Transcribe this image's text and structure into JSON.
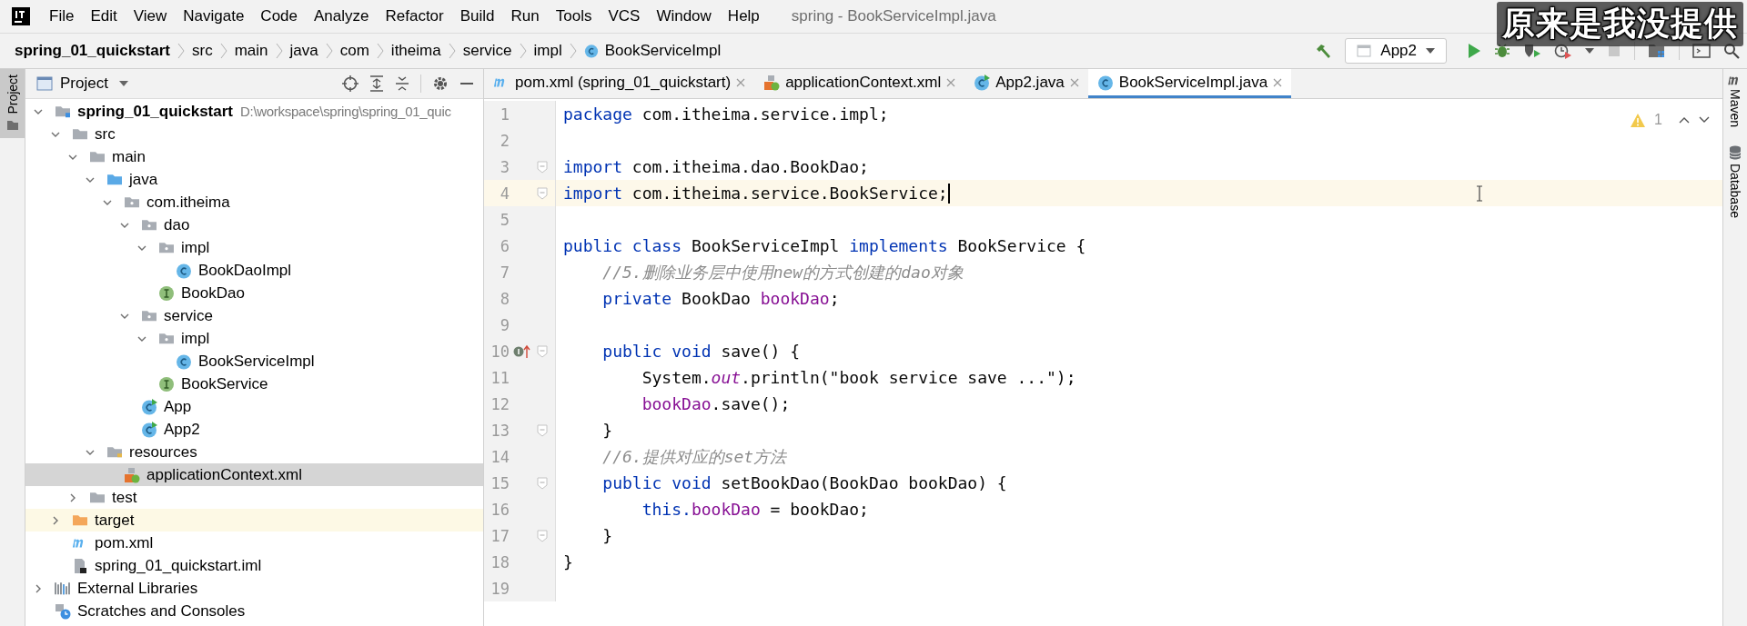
{
  "window": {
    "title": "spring - BookServiceImpl.java"
  },
  "menu": [
    "File",
    "Edit",
    "View",
    "Navigate",
    "Code",
    "Analyze",
    "Refactor",
    "Build",
    "Run",
    "Tools",
    "VCS",
    "Window",
    "Help"
  ],
  "subtitle": "原来是我没提供",
  "breadcrumbs": [
    {
      "label": "spring_01_quickstart",
      "kind": "project"
    },
    {
      "label": "src",
      "kind": "folder"
    },
    {
      "label": "main",
      "kind": "folder"
    },
    {
      "label": "java",
      "kind": "folder"
    },
    {
      "label": "com",
      "kind": "folder"
    },
    {
      "label": "itheima",
      "kind": "folder"
    },
    {
      "label": "service",
      "kind": "folder"
    },
    {
      "label": "impl",
      "kind": "folder"
    },
    {
      "label": "BookServiceImpl",
      "kind": "class"
    }
  ],
  "toolbar": {
    "run_config": "App2",
    "stop_disabled": true
  },
  "project_panel": {
    "title": "Project",
    "stripe_label": "Project"
  },
  "tree": [
    {
      "label": "spring_01_quickstart",
      "hint": "D:\\workspace\\spring\\spring_01_quic",
      "kind": "project",
      "expanded": true,
      "selected": false,
      "children": [
        {
          "label": "src",
          "kind": "folder",
          "expanded": true,
          "selected": false,
          "children": [
            {
              "label": "main",
              "kind": "folder",
              "expanded": true,
              "selected": false,
              "children": [
                {
                  "label": "java",
                  "kind": "source",
                  "expanded": true,
                  "selected": false,
                  "children": [
                    {
                      "label": "com.itheima",
                      "kind": "package",
                      "expanded": true,
                      "selected": false,
                      "children": [
                        {
                          "label": "dao",
                          "kind": "package",
                          "expanded": true,
                          "selected": false,
                          "children": [
                            {
                              "label": "impl",
                              "kind": "package",
                              "expanded": true,
                              "selected": false,
                              "children": [
                                {
                                  "label": "BookDaoImpl",
                                  "kind": "class",
                                  "selected": false
                                }
                              ]
                            },
                            {
                              "label": "BookDao",
                              "kind": "interface",
                              "selected": false
                            }
                          ]
                        },
                        {
                          "label": "service",
                          "kind": "package",
                          "expanded": true,
                          "selected": false,
                          "children": [
                            {
                              "label": "impl",
                              "kind": "package",
                              "expanded": true,
                              "selected": false,
                              "children": [
                                {
                                  "label": "BookServiceImpl",
                                  "kind": "class",
                                  "selected": false
                                }
                              ]
                            },
                            {
                              "label": "BookService",
                              "kind": "interface",
                              "selected": false
                            }
                          ]
                        },
                        {
                          "label": "App",
                          "kind": "runnable",
                          "selected": false
                        },
                        {
                          "label": "App2",
                          "kind": "runnable",
                          "selected": false
                        }
                      ]
                    }
                  ]
                },
                {
                  "label": "resources",
                  "kind": "resources",
                  "expanded": true,
                  "selected": false,
                  "children": [
                    {
                      "label": "applicationContext.xml",
                      "kind": "xml",
                      "selected": true
                    }
                  ]
                }
              ]
            },
            {
              "label": "test",
              "kind": "folder",
              "expanded": false,
              "selected": false
            }
          ]
        },
        {
          "label": "target",
          "kind": "excluded",
          "expanded": false,
          "selected": false
        },
        {
          "label": "pom.xml",
          "kind": "maven",
          "selected": false
        },
        {
          "label": "spring_01_quickstart.iml",
          "kind": "iml",
          "selected": false
        }
      ]
    },
    {
      "label": "External Libraries",
      "kind": "libraries",
      "expanded": false,
      "selected": false
    },
    {
      "label": "Scratches and Consoles",
      "kind": "scratches",
      "selected": false
    }
  ],
  "tabs": [
    {
      "label": "pom.xml (spring_01_quickstart)",
      "kind": "maven",
      "selected": false
    },
    {
      "label": "applicationContext.xml",
      "kind": "xml",
      "selected": false
    },
    {
      "label": "App2.java",
      "kind": "runnable",
      "selected": false
    },
    {
      "label": "BookServiceImpl.java",
      "kind": "class",
      "selected": true
    }
  ],
  "inspection": {
    "warnings": "1"
  },
  "code": [
    {
      "number": "1",
      "fold": false,
      "current": false,
      "implements_marker": false,
      "tokens": [
        {
          "text": "package",
          "kind": "kw"
        },
        {
          "text": " com.itheima.service.impl;",
          "kind": "plain"
        }
      ]
    },
    {
      "number": "2",
      "fold": false,
      "current": false,
      "implements_marker": false
    },
    {
      "number": "3",
      "fold": true,
      "current": false,
      "implements_marker": false,
      "tokens": [
        {
          "text": "import",
          "kind": "kw"
        },
        {
          "text": " com.itheima.dao.BookDao;",
          "kind": "plain"
        }
      ]
    },
    {
      "number": "4",
      "fold": true,
      "current": true,
      "implements_marker": false,
      "tokens": [
        {
          "text": "import",
          "kind": "kw"
        },
        {
          "text": " com.itheima.service.BookService;",
          "kind": "plain"
        }
      ]
    },
    {
      "number": "5",
      "fold": false,
      "current": false,
      "implements_marker": false
    },
    {
      "number": "6",
      "fold": false,
      "current": false,
      "implements_marker": false,
      "tokens": [
        {
          "text": "public class",
          "kind": "kw"
        },
        {
          "text": " BookServiceImpl ",
          "kind": "plain"
        },
        {
          "text": "implements",
          "kind": "kw"
        },
        {
          "text": " BookService {",
          "kind": "plain"
        }
      ]
    },
    {
      "number": "7",
      "fold": false,
      "current": false,
      "implements_marker": false,
      "tokens": [
        {
          "text": "    //5.删除业务层中使用new的方式创建的dao对象",
          "kind": "comment"
        }
      ]
    },
    {
      "number": "8",
      "fold": false,
      "current": false,
      "implements_marker": false,
      "tokens": [
        {
          "text": "    private",
          "kind": "kw"
        },
        {
          "text": " BookDao ",
          "kind": "plain"
        },
        {
          "text": "bookDao",
          "kind": "field"
        },
        {
          "text": ";",
          "kind": "plain"
        }
      ]
    },
    {
      "number": "9",
      "fold": false,
      "current": false,
      "implements_marker": false
    },
    {
      "number": "10",
      "fold": true,
      "current": false,
      "implements_marker": true,
      "tokens": [
        {
          "text": "    public void",
          "kind": "kw"
        },
        {
          "text": " save() {",
          "kind": "plain"
        }
      ]
    },
    {
      "number": "11",
      "fold": false,
      "current": false,
      "implements_marker": false,
      "tokens": [
        {
          "text": "        System.",
          "kind": "plain"
        },
        {
          "text": "out",
          "kind": "static"
        },
        {
          "text": ".println(\"book service save ...\");",
          "kind": "plain"
        }
      ]
    },
    {
      "number": "12",
      "fold": false,
      "current": false,
      "implements_marker": false,
      "tokens": [
        {
          "text": "        bookDao",
          "kind": "field"
        },
        {
          "text": ".save();",
          "kind": "plain"
        }
      ]
    },
    {
      "number": "13",
      "fold": true,
      "current": false,
      "implements_marker": false,
      "tokens": [
        {
          "text": "    }",
          "kind": "plain"
        }
      ]
    },
    {
      "number": "14",
      "fold": false,
      "current": false,
      "implements_marker": false,
      "tokens": [
        {
          "text": "    //6.提供对应的set方法",
          "kind": "comment"
        }
      ]
    },
    {
      "number": "15",
      "fold": true,
      "current": false,
      "implements_marker": false,
      "tokens": [
        {
          "text": "    public void",
          "kind": "kw"
        },
        {
          "text": " setBookDao(BookDao bookDao) {",
          "kind": "plain"
        }
      ]
    },
    {
      "number": "16",
      "fold": false,
      "current": false,
      "implements_marker": false,
      "tokens": [
        {
          "text": "        this.",
          "kind": "kw"
        },
        {
          "text": "bookDao",
          "kind": "field"
        },
        {
          "text": " = bookDao;",
          "kind": "plain"
        }
      ]
    },
    {
      "number": "17",
      "fold": true,
      "current": false,
      "implements_marker": false,
      "tokens": [
        {
          "text": "    }",
          "kind": "plain"
        }
      ]
    },
    {
      "number": "18",
      "fold": false,
      "current": false,
      "implements_marker": false,
      "tokens": [
        {
          "text": "}",
          "kind": "plain"
        }
      ]
    },
    {
      "number": "19",
      "fold": false,
      "current": false,
      "implements_marker": false
    }
  ],
  "right_stripe": [
    {
      "label": "Maven",
      "kind": "maven"
    },
    {
      "label": "Database",
      "kind": "database"
    }
  ]
}
